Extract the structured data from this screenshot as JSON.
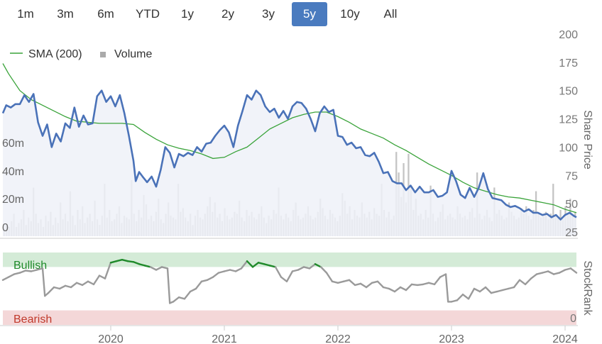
{
  "range_selector": {
    "buttons": [
      "1m",
      "3m",
      "6m",
      "YTD",
      "1y",
      "2y",
      "3y",
      "5y",
      "10y",
      "All"
    ],
    "active": "5y",
    "active_color": "#4a7bbf"
  },
  "legend": {
    "sma_label": "SMA (200)",
    "volume_label": "Volume",
    "sma_color": "#3aa33a",
    "volume_color": "#aaaaaa"
  },
  "colors": {
    "price": "#4a72b8",
    "price_fill": "#eef1f8",
    "sma": "#3aa33a",
    "volume": "#c4c4c4",
    "bullish_band": "#d4ebd7",
    "bearish_band": "#f4d7d8",
    "bullish_line": "#1f8a2a",
    "neutral_line": "#9a9a9a"
  },
  "chart_data": [
    {
      "type": "line",
      "panel": "price",
      "y_axis_right_title": "Share Price",
      "y_axis_right_ticks": [
        200,
        175,
        150,
        125,
        100,
        75,
        50,
        25
      ],
      "ylim": [
        25,
        200
      ],
      "y_axis_left_title": "",
      "y_axis_left_ticks": [
        "60m",
        "40m",
        "20m",
        "0"
      ],
      "y_axis_left_values": [
        60,
        40,
        20,
        0
      ],
      "volume_ylim_m": [
        0,
        150
      ],
      "x_axis_ticks": [
        "2020",
        "2021",
        "2022",
        "2023",
        "2024"
      ],
      "x_axis_tick_times": [
        2020.0,
        2021.0,
        2022.0,
        2023.0,
        2024.0
      ],
      "xlim": [
        2019.05,
        2024.1
      ],
      "series": [
        {
          "name": "price",
          "x": [
            2019.05,
            2019.08,
            2019.12,
            2019.16,
            2019.2,
            2019.24,
            2019.28,
            2019.32,
            2019.36,
            2019.4,
            2019.44,
            2019.48,
            2019.52,
            2019.56,
            2019.6,
            2019.64,
            2019.68,
            2019.72,
            2019.76,
            2019.8,
            2019.84,
            2019.88,
            2019.92,
            2019.96,
            2020.0,
            2020.04,
            2020.08,
            2020.12,
            2020.16,
            2020.2,
            2020.22,
            2020.25,
            2020.28,
            2020.32,
            2020.36,
            2020.4,
            2020.44,
            2020.48,
            2020.52,
            2020.56,
            2020.6,
            2020.64,
            2020.68,
            2020.72,
            2020.76,
            2020.8,
            2020.84,
            2020.88,
            2020.92,
            2020.96,
            2021.0,
            2021.04,
            2021.08,
            2021.12,
            2021.16,
            2021.2,
            2021.24,
            2021.28,
            2021.32,
            2021.36,
            2021.4,
            2021.44,
            2021.48,
            2021.52,
            2021.56,
            2021.6,
            2021.64,
            2021.68,
            2021.72,
            2021.76,
            2021.8,
            2021.84,
            2021.88,
            2021.92,
            2021.96,
            2022.0,
            2022.04,
            2022.08,
            2022.12,
            2022.16,
            2022.2,
            2022.24,
            2022.28,
            2022.32,
            2022.36,
            2022.4,
            2022.44,
            2022.48,
            2022.52,
            2022.56,
            2022.6,
            2022.64,
            2022.68,
            2022.72,
            2022.76,
            2022.8,
            2022.84,
            2022.88,
            2022.92,
            2022.96,
            2023.0,
            2023.04,
            2023.08,
            2023.12,
            2023.16,
            2023.2,
            2023.24,
            2023.28,
            2023.32,
            2023.36,
            2023.4,
            2023.44,
            2023.48,
            2023.52,
            2023.56,
            2023.6,
            2023.64,
            2023.68,
            2023.72,
            2023.76,
            2023.8,
            2023.84,
            2023.88,
            2023.92,
            2023.96,
            2024.0,
            2024.04,
            2024.08,
            2024.1
          ],
          "values": [
            130,
            137,
            135,
            138,
            138,
            146,
            140,
            147,
            122,
            110,
            120,
            100,
            112,
            105,
            121,
            117,
            135,
            118,
            128,
            120,
            121,
            145,
            150,
            140,
            145,
            136,
            146,
            130,
            110,
            88,
            70,
            78,
            74,
            69,
            74,
            65,
            80,
            100,
            95,
            82,
            94,
            92,
            95,
            93,
            100,
            96,
            103,
            104,
            110,
            115,
            119,
            113,
            100,
            119,
            132,
            146,
            142,
            150,
            146,
            136,
            131,
            134,
            126,
            132,
            125,
            136,
            140,
            139,
            134,
            125,
            114,
            130,
            136,
            131,
            133,
            110,
            109,
            102,
            104,
            99,
            100,
            93,
            92,
            95,
            87,
            77,
            78,
            70,
            68,
            68,
            62,
            66,
            60,
            65,
            60,
            60,
            62,
            56,
            57,
            60,
            79,
            70,
            58,
            55,
            64,
            56,
            64,
            77,
            63,
            55,
            54,
            53,
            49,
            47,
            48,
            46,
            43,
            45,
            42,
            42,
            40,
            41,
            38,
            40,
            36,
            40,
            42,
            39,
            38
          ]
        },
        {
          "name": "SMA (200)",
          "x": [
            2019.05,
            2019.1,
            2019.2,
            2019.3,
            2019.4,
            2019.5,
            2019.6,
            2019.7,
            2019.8,
            2019.9,
            2020.0,
            2020.1,
            2020.2,
            2020.3,
            2020.4,
            2020.5,
            2020.6,
            2020.7,
            2020.8,
            2020.9,
            2021.0,
            2021.1,
            2021.2,
            2021.3,
            2021.4,
            2021.5,
            2021.6,
            2021.7,
            2021.8,
            2021.9,
            2022.0,
            2022.1,
            2022.2,
            2022.3,
            2022.4,
            2022.5,
            2022.6,
            2022.7,
            2022.8,
            2022.9,
            2023.0,
            2023.1,
            2023.2,
            2023.3,
            2023.4,
            2023.5,
            2023.6,
            2023.7,
            2023.8,
            2023.9,
            2024.0,
            2024.1
          ],
          "values": [
            174,
            165,
            150,
            142,
            137,
            132,
            127,
            123,
            122,
            121,
            121,
            121,
            120,
            113,
            107,
            102,
            99,
            97,
            94,
            90,
            91,
            96,
            100,
            108,
            116,
            121,
            126,
            129,
            131,
            131,
            127,
            122,
            116,
            112,
            108,
            102,
            97,
            91,
            85,
            80,
            75,
            69,
            64,
            61,
            58,
            56,
            55,
            53,
            51,
            49,
            45,
            42
          ]
        }
      ],
      "volume_m": [
        4,
        6,
        5,
        8,
        12,
        5,
        7,
        9,
        14,
        6,
        10,
        8,
        26,
        12,
        7,
        9,
        5,
        11,
        8,
        13,
        6,
        10,
        7,
        18,
        9,
        12,
        8,
        24,
        11,
        6,
        14,
        9,
        16,
        7,
        10,
        12,
        8,
        19,
        9,
        6,
        11,
        28,
        10,
        14,
        8,
        9,
        12,
        16,
        7,
        11,
        10,
        9,
        30,
        12,
        8,
        14,
        10,
        22,
        17,
        9,
        11,
        8,
        13,
        20,
        9,
        7,
        12,
        18,
        11,
        10,
        9,
        28,
        13,
        15,
        10,
        8,
        12,
        6,
        11,
        14,
        10,
        9,
        12,
        16,
        21,
        13,
        18,
        10,
        12,
        8,
        15,
        11,
        9,
        10,
        13,
        12,
        19,
        10,
        8,
        14,
        11,
        13,
        10,
        9,
        12,
        16,
        10,
        7,
        11,
        9,
        14,
        12,
        26,
        11,
        9,
        12,
        10,
        8,
        14,
        18,
        11,
        9,
        10,
        12,
        16,
        11,
        9,
        10,
        13,
        20,
        15,
        11,
        9,
        14,
        12,
        10,
        8,
        11,
        23,
        19,
        12,
        16,
        9,
        14,
        11,
        10,
        18,
        12,
        10,
        13,
        9,
        15,
        12,
        11,
        28,
        14,
        10,
        13,
        9,
        11,
        45,
        34,
        21,
        39,
        18,
        44,
        27,
        14,
        20,
        11,
        12,
        9,
        14,
        10,
        27,
        12,
        8,
        10,
        13,
        17,
        9,
        11,
        12,
        10,
        9,
        16,
        12,
        10,
        11,
        9,
        13,
        15,
        10,
        34,
        12,
        9,
        11,
        14,
        10,
        8,
        26,
        12,
        14,
        11,
        9,
        10,
        18,
        13,
        11,
        9,
        10,
        15,
        12,
        16,
        11,
        9,
        14,
        24,
        12,
        10,
        11,
        13,
        9,
        12,
        28,
        11,
        10,
        14,
        9,
        16,
        12,
        20,
        11,
        13
      ]
    },
    {
      "type": "line",
      "panel": "stockrank",
      "y_axis_right_title": "StockRank",
      "y_axis_right_ticks": [
        0
      ],
      "ylim": [
        0,
        100
      ],
      "bands": [
        {
          "label": "Bullish",
          "from": 80,
          "to": 100
        },
        {
          "label": "Bearish",
          "from": 0,
          "to": 20
        }
      ],
      "series": [
        {
          "name": "stockrank",
          "x": [
            2019.05,
            2019.1,
            2019.15,
            2019.2,
            2019.25,
            2019.3,
            2019.35,
            2019.4,
            2019.42,
            2019.45,
            2019.5,
            2019.55,
            2019.6,
            2019.65,
            2019.7,
            2019.75,
            2019.8,
            2019.85,
            2019.9,
            2019.95,
            2020.0,
            2020.05,
            2020.1,
            2020.15,
            2020.2,
            2020.25,
            2020.3,
            2020.35,
            2020.4,
            2020.45,
            2020.5,
            2020.52,
            2020.55,
            2020.6,
            2020.65,
            2020.7,
            2020.75,
            2020.8,
            2020.85,
            2020.9,
            2020.95,
            2021.0,
            2021.05,
            2021.1,
            2021.15,
            2021.2,
            2021.25,
            2021.3,
            2021.35,
            2021.4,
            2021.45,
            2021.5,
            2021.55,
            2021.6,
            2021.65,
            2021.7,
            2021.75,
            2021.8,
            2021.85,
            2021.9,
            2021.95,
            2022.0,
            2022.05,
            2022.1,
            2022.15,
            2022.2,
            2022.25,
            2022.3,
            2022.35,
            2022.4,
            2022.45,
            2022.5,
            2022.55,
            2022.6,
            2022.65,
            2022.7,
            2022.75,
            2022.8,
            2022.85,
            2022.9,
            2022.95,
            2022.97,
            2023.0,
            2023.05,
            2023.1,
            2023.15,
            2023.2,
            2023.25,
            2023.3,
            2023.35,
            2023.4,
            2023.45,
            2023.5,
            2023.55,
            2023.6,
            2023.65,
            2023.7,
            2023.75,
            2023.8,
            2023.85,
            2023.9,
            2023.95,
            2024.0,
            2024.05,
            2024.1
          ],
          "values": [
            62,
            66,
            70,
            72,
            75,
            74,
            76,
            78,
            40,
            44,
            52,
            50,
            54,
            52,
            58,
            55,
            60,
            56,
            68,
            64,
            86,
            88,
            90,
            88,
            87,
            84,
            82,
            80,
            76,
            80,
            78,
            30,
            32,
            38,
            36,
            46,
            50,
            60,
            62,
            66,
            72,
            74,
            76,
            74,
            78,
            88,
            80,
            86,
            84,
            82,
            80,
            66,
            60,
            74,
            76,
            80,
            78,
            84,
            80,
            72,
            60,
            58,
            60,
            62,
            55,
            57,
            52,
            58,
            60,
            52,
            50,
            46,
            52,
            48,
            56,
            55,
            56,
            58,
            56,
            66,
            70,
            32,
            32,
            34,
            42,
            36,
            50,
            46,
            52,
            44,
            46,
            48,
            50,
            52,
            62,
            56,
            64,
            70,
            72,
            74,
            70,
            72,
            76,
            78,
            72
          ]
        }
      ],
      "bullish_threshold": 80
    }
  ]
}
